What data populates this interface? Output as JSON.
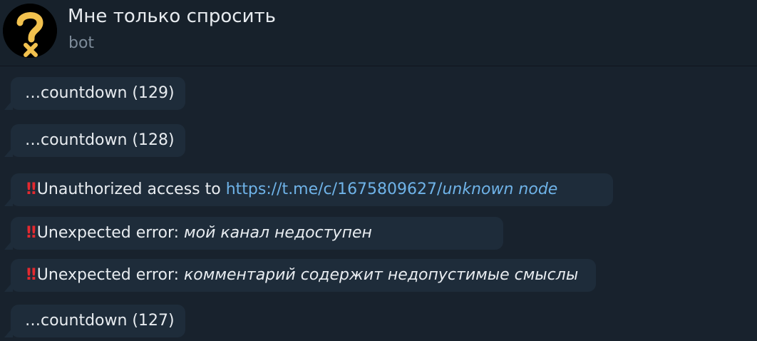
{
  "header": {
    "title": "Мне только спросить",
    "subtitle": "bot",
    "avatar_icon": "question-mark-icon",
    "avatar_colors": {
      "background": "#000000",
      "mark": "#f2c14e"
    }
  },
  "messages": [
    {
      "type": "countdown",
      "text": "…countdown (129)"
    },
    {
      "type": "countdown",
      "text": "…countdown (128)"
    },
    {
      "type": "error",
      "icon": "double-exclamation-icon",
      "symbol": "‼",
      "prefix": "Unauthorized access to ",
      "link_text": "https://t.me/c/1675809627/",
      "link_italic": "unknown node"
    },
    {
      "type": "error",
      "icon": "double-exclamation-icon",
      "symbol": "‼",
      "prefix": "Unexpected error: ",
      "detail": "мой канал недоступен"
    },
    {
      "type": "error",
      "icon": "double-exclamation-icon",
      "symbol": "‼",
      "prefix": "Unexpected error: ",
      "detail": "комментарий содержит недопустимые смыслы"
    },
    {
      "type": "countdown",
      "text": "…countdown (127)"
    }
  ],
  "colors": {
    "background": "#18222d",
    "bubble": "#1e2c3a",
    "link": "#6fb3e8",
    "warning": "#e4292f"
  }
}
